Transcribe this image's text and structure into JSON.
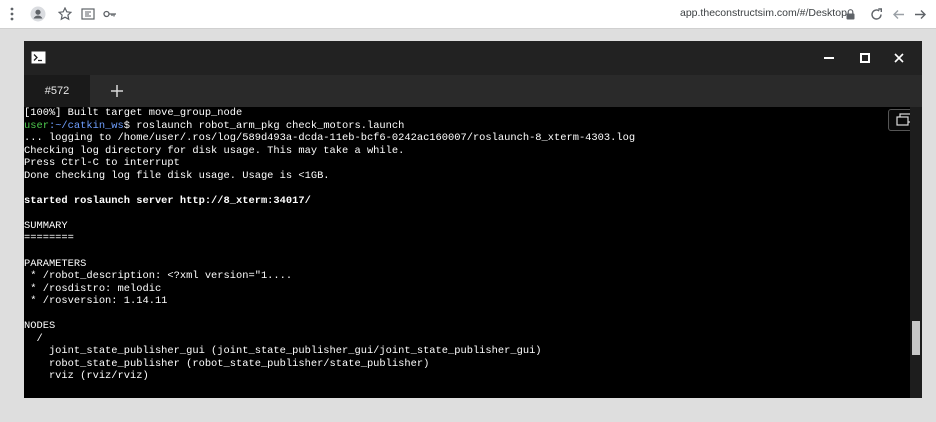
{
  "browser": {
    "url": "app.theconstructsim.com/#/Desktop"
  },
  "terminal": {
    "tab_label": "#572",
    "lines": [
      [
        {
          "t": "[100%] Built target move_group_node",
          "c": ""
        }
      ],
      [
        {
          "t": "user",
          "c": "green"
        },
        {
          "t": ":~/catkin_ws",
          "c": "blue"
        },
        {
          "t": "$ roslaunch robot_arm_pkg check_motors.launch",
          "c": ""
        }
      ],
      [
        {
          "t": "... logging to /home/user/.ros/log/589d493a-dcda-11eb-bcf6-0242ac160007/roslaunch-8_xterm-4303.log",
          "c": ""
        }
      ],
      [
        {
          "t": "Checking log directory for disk usage. This may take a while.",
          "c": ""
        }
      ],
      [
        {
          "t": "Press Ctrl-C to interrupt",
          "c": ""
        }
      ],
      [
        {
          "t": "Done checking log file disk usage. Usage is <1GB.",
          "c": ""
        }
      ],
      [
        {
          "t": "",
          "c": ""
        }
      ],
      [
        {
          "t": "started roslaunch server http://8_xterm:34017/",
          "c": "bold"
        }
      ],
      [
        {
          "t": "",
          "c": ""
        }
      ],
      [
        {
          "t": "SUMMARY",
          "c": ""
        }
      ],
      [
        {
          "t": "========",
          "c": ""
        }
      ],
      [
        {
          "t": "",
          "c": ""
        }
      ],
      [
        {
          "t": "PARAMETERS",
          "c": ""
        }
      ],
      [
        {
          "t": " * /robot_description: <?xml version=\"1....",
          "c": ""
        }
      ],
      [
        {
          "t": " * /rosdistro: melodic",
          "c": ""
        }
      ],
      [
        {
          "t": " * /rosversion: 1.14.11",
          "c": ""
        }
      ],
      [
        {
          "t": "",
          "c": ""
        }
      ],
      [
        {
          "t": "NODES",
          "c": ""
        }
      ],
      [
        {
          "t": "  /",
          "c": ""
        }
      ],
      [
        {
          "t": "    joint_state_publisher_gui (joint_state_publisher_gui/joint_state_publisher_gui)",
          "c": ""
        }
      ],
      [
        {
          "t": "    robot_state_publisher (robot_state_publisher/state_publisher)",
          "c": ""
        }
      ],
      [
        {
          "t": "    rviz (rviz/rviz)",
          "c": ""
        }
      ]
    ]
  }
}
